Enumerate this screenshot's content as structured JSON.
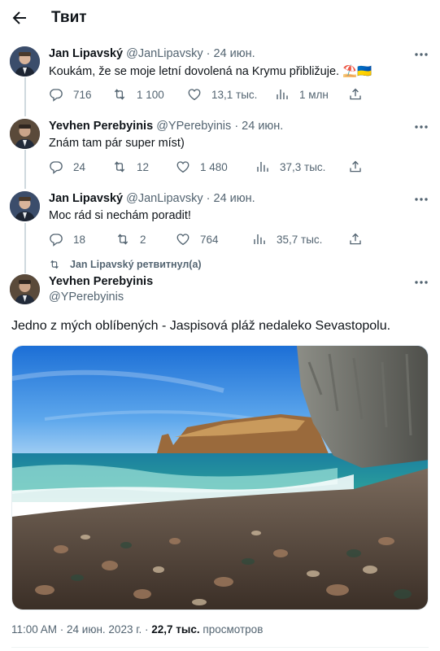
{
  "header": {
    "title": "Твит"
  },
  "replies": [
    {
      "name": "Jan Lipavský",
      "handle": "@JanLipavsky",
      "date": "· 24 июн.",
      "text": "Koukám, že se moje letní dovolená na Krymu přibližuje. ⛱️🇺🇦",
      "stats": {
        "replies": "716",
        "retweets": "1 100",
        "likes": "13,1 тыс.",
        "views": "1 млн"
      }
    },
    {
      "name": "Yevhen Perebyinis",
      "handle": "@YPerebyinis",
      "date": "· 24 июн.",
      "text": "Znám tam pár super míst)",
      "stats": {
        "replies": "24",
        "retweets": "12",
        "likes": "1 480",
        "views": "37,3 тыс."
      }
    },
    {
      "name": "Jan Lipavský",
      "handle": "@JanLipavsky",
      "date": "· 24 июн.",
      "text": "Moc rád si nechám poradit!",
      "stats": {
        "replies": "18",
        "retweets": "2",
        "likes": "764",
        "views": "35,7 тыс."
      }
    }
  ],
  "main_tweet": {
    "retweeted_by": "Jan Lipavský ретвитнул(а)",
    "name": "Yevhen Perebyinis",
    "handle": "@YPerebyinis",
    "text": "Jedno z mých oblíbených - Jaspisová pláž nedaleko Sevastopolu.",
    "time": "11:00 AM · 24 июн. 2023 г. · ",
    "views": "22,7 тыс.",
    "views_label": " просмотров"
  },
  "colors": {
    "text": "#0f1419",
    "secondary": "#536471",
    "line": "#cfd9de"
  },
  "icons": [
    "back-arrow-icon",
    "more-icon",
    "reply-icon",
    "retweet-icon",
    "like-icon",
    "views-icon",
    "share-icon"
  ]
}
